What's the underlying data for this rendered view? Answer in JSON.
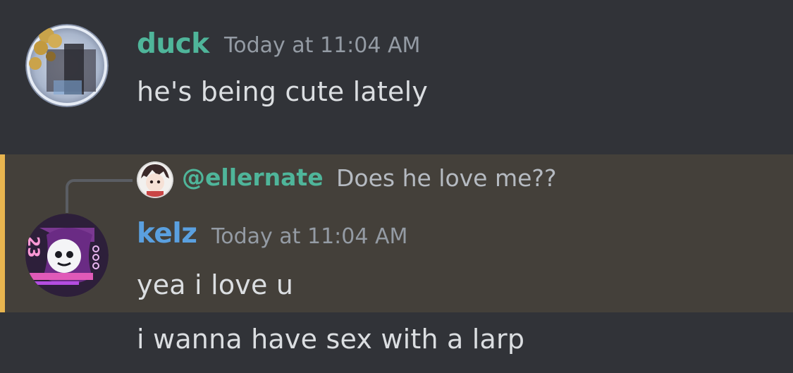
{
  "messages": [
    {
      "username": "duck",
      "username_color": "#4fb59a",
      "timestamp": "Today at 11:04 AM",
      "text": "he's being cute lately",
      "avatar": "avatar-duck"
    },
    {
      "username": "kelz",
      "username_color": "#5aa0e0",
      "timestamp": "Today at 11:04 AM",
      "text": "yea i love u",
      "avatar": "avatar-kelz",
      "highlighted": true,
      "reply": {
        "user": "@ellernate",
        "text": "Does he love me??",
        "avatar": "avatar-ellernate"
      }
    },
    {
      "text": "i wanna have sex with a larp",
      "continuation": true
    }
  ],
  "colors": {
    "background": "#313338",
    "highlight_background": "#44403a",
    "mention_bar": "#e8b54f",
    "timestamp": "#949ba4",
    "text": "#dbdee1"
  }
}
